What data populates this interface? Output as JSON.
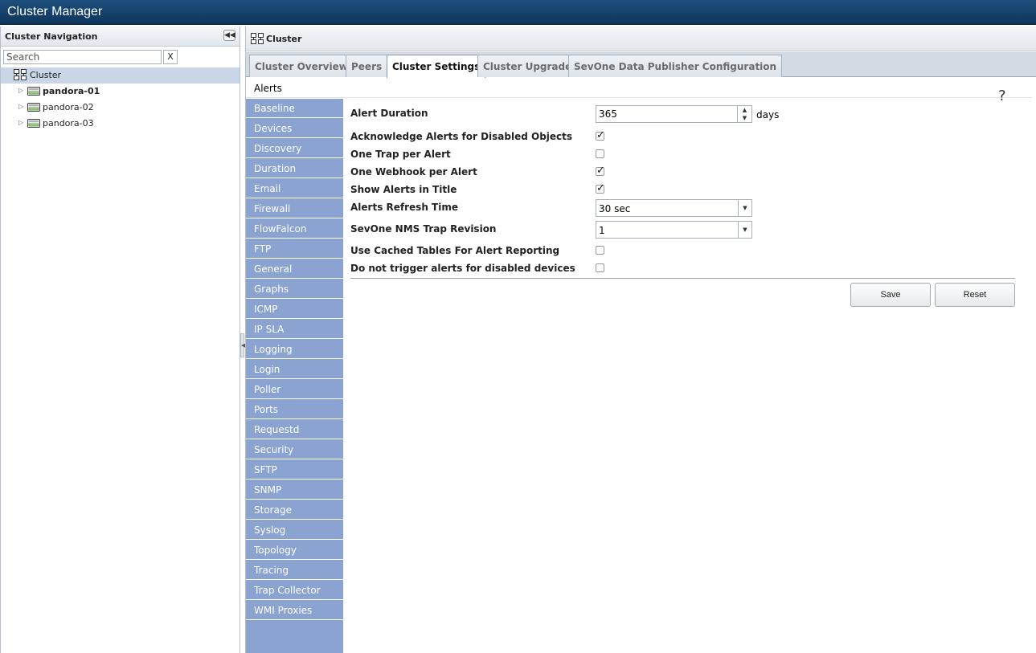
{
  "app": {
    "title": "Cluster Manager"
  },
  "left_panel": {
    "title": "Cluster Navigation",
    "search_placeholder": "Search",
    "clear_label": "X",
    "tree": [
      {
        "label": "Cluster",
        "bold": false,
        "root": true
      },
      {
        "label": "pandora-01",
        "bold": true
      },
      {
        "label": "pandora-02",
        "bold": false
      },
      {
        "label": "pandora-03",
        "bold": false
      }
    ]
  },
  "right_panel": {
    "title": "Cluster",
    "tabs": [
      {
        "label": "Cluster Overview",
        "active": false
      },
      {
        "label": "Peers",
        "active": false
      },
      {
        "label": "Cluster Settings",
        "active": true
      },
      {
        "label": "Cluster Upgrade",
        "active": false
      },
      {
        "label": "SevOne Data Publisher Configuration",
        "active": false
      }
    ],
    "subtab": "Alerts",
    "help": "?",
    "settings_nav": [
      "Baseline",
      "Devices",
      "Discovery",
      "Duration",
      "Email",
      "Firewall",
      "FlowFalcon",
      "FTP",
      "General",
      "Graphs",
      "ICMP",
      "IP SLA",
      "Logging",
      "Login",
      "Poller",
      "Ports",
      "Requestd",
      "Security",
      "SFTP",
      "SNMP",
      "Storage",
      "Syslog",
      "Topology",
      "Tracing",
      "Trap Collector",
      "WMI Proxies"
    ],
    "form": {
      "alert_duration": {
        "label": "Alert Duration",
        "value": "365",
        "unit": "days"
      },
      "ack_disabled": {
        "label": "Acknowledge Alerts for Disabled Objects",
        "checked": true
      },
      "one_trap": {
        "label": "One Trap per Alert",
        "checked": false
      },
      "one_webhook": {
        "label": "One Webhook per Alert",
        "checked": true
      },
      "show_in_title": {
        "label": "Show Alerts in Title",
        "checked": true
      },
      "refresh_time": {
        "label": "Alerts Refresh Time",
        "value": "30 sec"
      },
      "trap_revision": {
        "label": "SevOne NMS Trap Revision",
        "value": "1"
      },
      "cached_tables": {
        "label": "Use Cached Tables For Alert Reporting",
        "checked": false
      },
      "no_trigger_disabled": {
        "label": "Do not trigger alerts for disabled devices",
        "checked": false
      }
    },
    "buttons": {
      "save": "Save",
      "reset": "Reset"
    }
  }
}
